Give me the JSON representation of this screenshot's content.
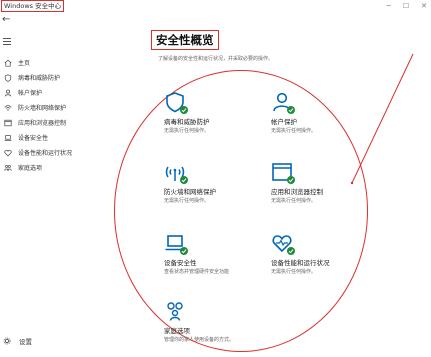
{
  "window": {
    "title": "Windows 安全中心"
  },
  "sidebar": {
    "items": [
      {
        "icon": "home-icon",
        "label": "主页"
      },
      {
        "icon": "shield-icon",
        "label": "病毒和威胁防护"
      },
      {
        "icon": "person-icon",
        "label": "帐户保护"
      },
      {
        "icon": "wifi-icon",
        "label": "防火墙和网络保护"
      },
      {
        "icon": "app-browser-icon",
        "label": "应用和浏览器控制"
      },
      {
        "icon": "laptop-icon",
        "label": "设备安全性"
      },
      {
        "icon": "heart-icon",
        "label": "设备性能和运行状况"
      },
      {
        "icon": "family-icon",
        "label": "家庭选项"
      }
    ],
    "settings_label": "设置"
  },
  "main": {
    "title": "安全性概览",
    "subtitle": "了解设备的安全性和运行状况，并采取必要的操作。",
    "tiles": [
      {
        "icon": "shield-icon",
        "name": "病毒和威胁防护",
        "status": "无需执行任何操作。"
      },
      {
        "icon": "person-icon",
        "name": "帐户保护",
        "status": "无需执行任何操作。"
      },
      {
        "icon": "wifi-icon",
        "name": "防火墙和网络保护",
        "status": "无需执行任何操作。"
      },
      {
        "icon": "app-browser-icon",
        "name": "应用和浏览器控制",
        "status": "无需执行任何操作。"
      },
      {
        "icon": "laptop-icon",
        "name": "设备安全性",
        "status": "查看状态并管理硬件安全功能"
      },
      {
        "icon": "heart-icon",
        "name": "设备性能和运行状况",
        "status": "无需执行任何操作。"
      },
      {
        "icon": "family-icon",
        "name": "家庭选项",
        "status": "管理你的家人使用设备的方式。"
      }
    ]
  },
  "colors": {
    "accent": "#0067b8",
    "ok_green": "#1f8a3a",
    "annotation_red": "#d8302f"
  }
}
